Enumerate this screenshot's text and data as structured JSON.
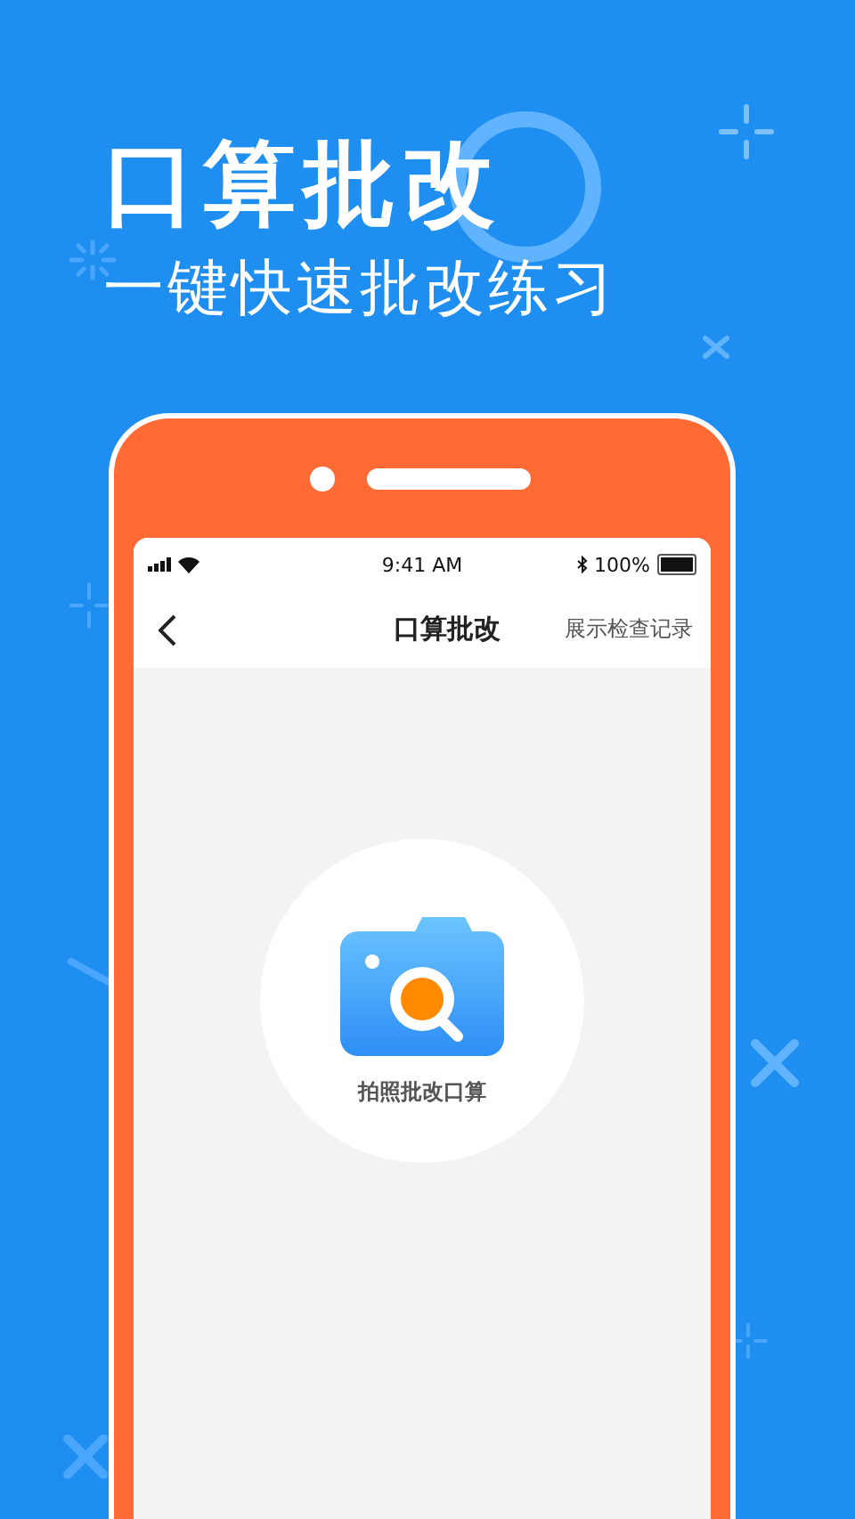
{
  "headline": {
    "title": "口算批改",
    "subtitle": "一键快速批改练习"
  },
  "phone": {
    "status_bar": {
      "time": "9:41 AM",
      "battery": "100%"
    },
    "nav": {
      "title": "口算批改",
      "action": "展示检查记录"
    },
    "capture": {
      "label": "拍照批改口算"
    }
  }
}
